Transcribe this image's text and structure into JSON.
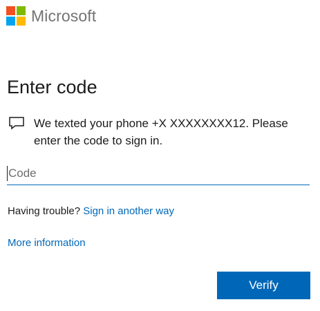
{
  "brand": {
    "name": "Microsoft",
    "logo_colors": [
      "#f25022",
      "#7fba00",
      "#00a4ef",
      "#ffb900"
    ]
  },
  "title": "Enter code",
  "message": {
    "icon": "message-icon",
    "text": "We texted your phone +X XXXXXXXX12. Please enter the code to sign in."
  },
  "code_field": {
    "value": "",
    "placeholder": "Code"
  },
  "trouble": {
    "prefix": "Having trouble?",
    "link": "Sign in another way"
  },
  "more_info": "More information",
  "verify_label": "Verify",
  "colors": {
    "accent": "#0067b8",
    "text": "#1b1b1b",
    "brand_gray": "#737373"
  }
}
